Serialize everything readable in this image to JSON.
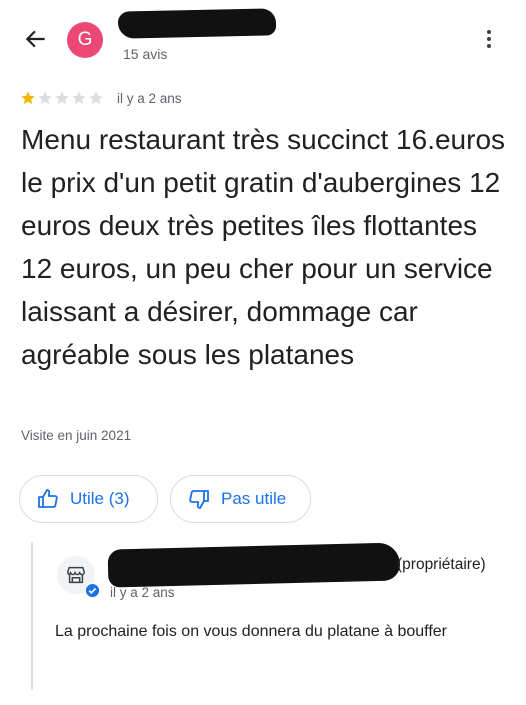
{
  "header": {
    "avatar_letter": "G",
    "avatar_color": "#ec4876",
    "review_count": "15 avis",
    "back_icon": "arrow-left-icon",
    "menu_icon": "more-vert-icon"
  },
  "review": {
    "rating": 1,
    "rating_max": 5,
    "time_ago": "il y a 2 ans",
    "text": "Menu restaurant très succinct 16.euros le prix d'un petit gratin d'aubergines 12 euros deux très petites îles flottantes 12 euros, un peu cher pour un service laissant a désirer, dommage car agréable sous les platanes",
    "visit": "Visite en juin 2021",
    "star_color": "#f4b400"
  },
  "actions": {
    "useful_label": "Utile (3)",
    "not_useful_label": "Pas utile",
    "accent": "#1a73e8"
  },
  "owner_reply": {
    "tag": "(propriétaire)",
    "time_ago": "il y a 2 ans",
    "text": "La prochaine fois on vous donnera du platane à bouffer",
    "icon": "storefront-icon",
    "badge_icon": "verified-icon"
  }
}
